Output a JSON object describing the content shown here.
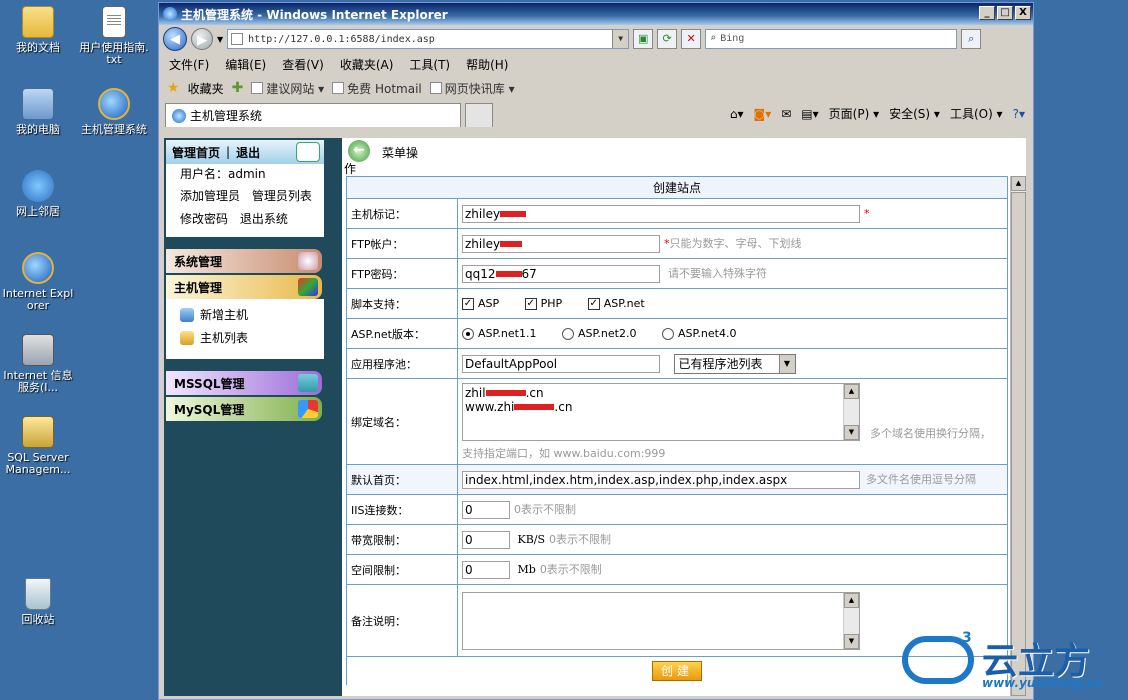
{
  "desktop": {
    "icons": [
      {
        "label": "我的文档"
      },
      {
        "label": "用户使用指南.txt"
      },
      {
        "label": "我的电脑"
      },
      {
        "label": "主机管理系统"
      },
      {
        "label": "网上邻居"
      },
      {
        "label": "Internet Explorer"
      },
      {
        "label": "Internet 信息服务(I..."
      },
      {
        "label": "SQL Server Managem..."
      },
      {
        "label": "回收站"
      }
    ]
  },
  "window": {
    "title": "主机管理系统 - Windows Internet Explorer",
    "btn_min": "_",
    "btn_max": "□",
    "btn_close": "X"
  },
  "address": {
    "url": "http://127.0.0.1:6588/index.asp",
    "search_placeholder": "Bing"
  },
  "menu": [
    "文件(F)",
    "编辑(E)",
    "查看(V)",
    "收藏夹(A)",
    "工具(T)",
    "帮助(H)"
  ],
  "favorites": {
    "label": "收藏夹",
    "links": [
      "建议网站 ▾",
      "免费 Hotmail",
      "网页快讯库 ▾"
    ]
  },
  "tab": {
    "title": "主机管理系统"
  },
  "commandbar": [
    "页面(P) ▾",
    "安全(S) ▾",
    "工具(O) ▾"
  ],
  "sidebar": {
    "home": "管理首页",
    "sep": "|",
    "logout": "退出",
    "username_label": "用户名：",
    "username": "admin",
    "links_row1": [
      "添加管理员",
      "管理员列表"
    ],
    "links_row2": [
      "修改密码",
      "退出系统"
    ],
    "sections": {
      "system": "系统管理",
      "host": "主机管理",
      "host_items": [
        "新增主机",
        "主机列表"
      ],
      "mssql": "MSSQL管理",
      "mysql": "MySQL管理"
    }
  },
  "main": {
    "menu_op_line1": "菜单操",
    "menu_op_line2": "作",
    "form_title": "创建站点",
    "rows": {
      "host_label": "主机标记：",
      "host_value": "zhiley",
      "ftp_label": "FTP帐户：",
      "ftp_value": "zhiley",
      "ftp_hint": "只能为数字、字母、下划线",
      "pwd_label": "FTP密码：",
      "pwd_value": "qq12",
      "pwd_value_tail": "67",
      "pwd_hint": "请不要输入特殊字符",
      "script_label": "脚本支持：",
      "scripts": [
        "ASP",
        "PHP",
        "ASP.net"
      ],
      "aspnet_label": "ASP.net版本：",
      "aspnet_versions": [
        "ASP.net1.1",
        "ASP.net2.0",
        "ASP.net4.0"
      ],
      "pool_label": "应用程序池：",
      "pool_value": "DefaultAppPool",
      "pool_select": "已有程序池列表",
      "domain_label": "绑定域名：",
      "domain_line1": "zhil",
      "domain_line1_tail": ".cn",
      "domain_line2": "www.zhi",
      "domain_line2_tail": ".cn",
      "domain_hint": "多个域名使用换行分隔，",
      "domain_port_hint": "支持指定端口，如 www.baidu.com:999",
      "index_label": "默认首页：",
      "index_value": "index.html,index.htm,index.asp,index.php,index.aspx",
      "index_hint": "多文件名使用逗号分隔",
      "iis_label": "IIS连接数：",
      "iis_value": "0",
      "iis_hint": "0表示不限制",
      "bw_label": "带宽限制：",
      "bw_value": "0",
      "bw_unit": "KB/S",
      "bw_hint": "0表示不限制",
      "space_label": "空间限制：",
      "space_value": "0",
      "space_unit": "Mb",
      "space_hint": "0表示不限制",
      "note_label": "备注说明：",
      "submit": "创建"
    }
  },
  "watermark": {
    "brand": "云立方",
    "url": "www.yunlifang.cn",
    "sup": "3"
  }
}
